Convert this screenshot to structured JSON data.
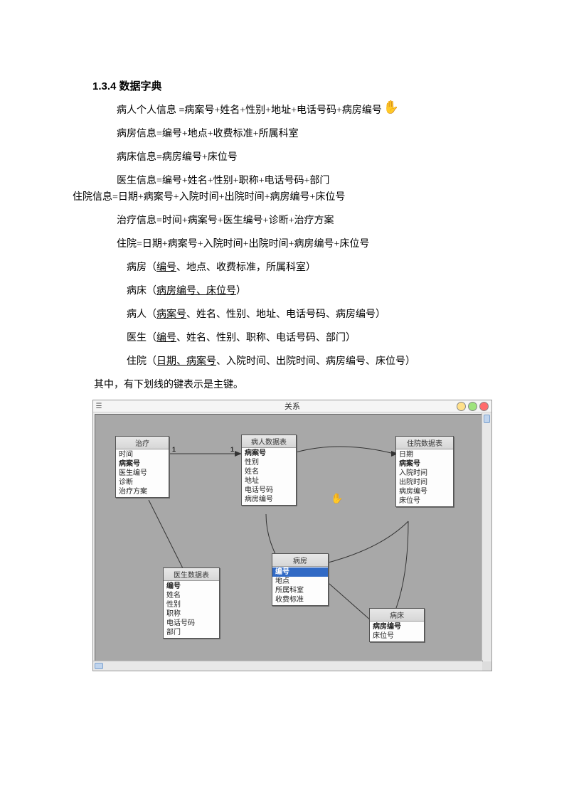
{
  "heading": "1.3.4 数据字典",
  "lines": {
    "l1": "病人个人信息 =病案号+姓名+性别+地址+电话号码+病房编号",
    "l2": "病房信息=编号+地点+收费标准+所属科室",
    "l3": "病床信息=病房编号+床位号",
    "l4": "医生信息=编号+姓名+性别+职称+电话号码+部门",
    "l5": "住院信息=日期+病案号+入院时间+出院时间+病房编号+床位号",
    "l6": "治疗信息=时间+病案号+医生编号+诊断+治疗方案",
    "l7": "住院=日期+病案号+入院时间+出院时间+病房编号+床位号"
  },
  "schema": {
    "ward": {
      "label": "病房",
      "pre": "（",
      "keys": "编号",
      "rest": "、地点、收费标准，所属科室）"
    },
    "bed": {
      "label": "病床",
      "pre": "（",
      "keys": "病房编号、床位号",
      "rest": "）"
    },
    "patient": {
      "label": "病人",
      "pre": "（",
      "keys": "病案号",
      "rest": "、姓名、性别、地址、电话号码、病房编号）"
    },
    "doctor": {
      "label": "医生",
      "pre": "（",
      "keys": "编号",
      "rest": "、姓名、性别、职称、电话号码、部门）"
    },
    "hosp": {
      "label": "住院",
      "pre": "（",
      "keys": "日期、病案号",
      "rest": "、入院时间、出院时间、病房编号、床位号）"
    }
  },
  "note": "其中，有下划线的键表示是主键。",
  "diagram": {
    "title": "关系",
    "tables": {
      "treat": {
        "title": "治疗",
        "fields": [
          "时间",
          "病案号",
          "医生编号",
          "诊断",
          "治疗方案"
        ],
        "keys": [
          "病案号"
        ]
      },
      "patient": {
        "title": "病人数据表",
        "fields": [
          "病案号",
          "性别",
          "姓名",
          "地址",
          "电话号码",
          "病房编号"
        ],
        "keys": [
          "病案号"
        ]
      },
      "hosp": {
        "title": "住院数据表",
        "fields": [
          "日期",
          "病案号",
          "入院时间",
          "出院时间",
          "病房编号",
          "床位号"
        ],
        "keys": [
          "病案号"
        ]
      },
      "doctor": {
        "title": "医生数据表",
        "fields": [
          "编号",
          "姓名",
          "性别",
          "职称",
          "电话号码",
          "部门"
        ],
        "keys": [
          "编号"
        ]
      },
      "ward": {
        "title": "病房",
        "fields": [
          "编号",
          "地点",
          "所属科室",
          "收费标准"
        ],
        "keys": [
          "编号"
        ],
        "selected": "编号"
      },
      "bed": {
        "title": "病床",
        "fields": [
          "病房编号",
          "床位号"
        ],
        "keys": [
          "病房编号"
        ]
      }
    },
    "cardinalities": {
      "one": "1",
      "many": "∞"
    }
  }
}
